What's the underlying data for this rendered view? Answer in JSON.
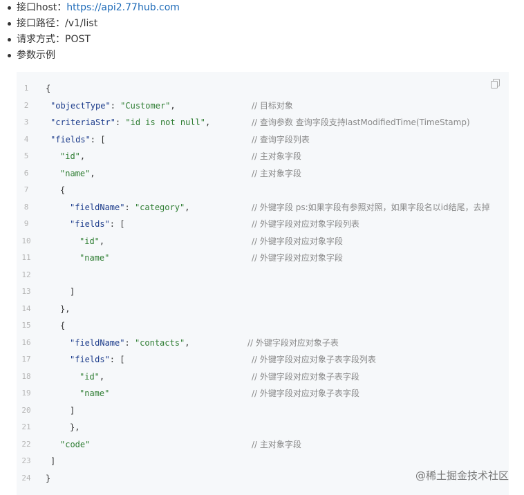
{
  "info": [
    {
      "label": "接口host：",
      "value": "https://api2.77hub.com",
      "is_link": true
    },
    {
      "label": "接口路径：",
      "value": "/v1/list",
      "is_link": false
    },
    {
      "label": "请求方式：",
      "value": "POST",
      "is_link": false
    },
    {
      "label": "参数示例",
      "value": "",
      "is_link": false
    }
  ],
  "code": {
    "copy_icon": "copy-icon",
    "lines": [
      {
        "n": "1",
        "indent": 0,
        "parts": [
          [
            "p",
            "{"
          ]
        ],
        "comment": ""
      },
      {
        "n": "2",
        "indent": 1,
        "parts": [
          [
            "k",
            "\"objectType\""
          ],
          [
            "p",
            ": "
          ],
          [
            "s",
            "\"Customer\""
          ],
          [
            "p",
            ","
          ]
        ],
        "comment": "// 目标对象"
      },
      {
        "n": "3",
        "indent": 1,
        "parts": [
          [
            "k",
            "\"criteriaStr\""
          ],
          [
            "p",
            ": "
          ],
          [
            "s",
            "\"id is not null\""
          ],
          [
            "p",
            ","
          ]
        ],
        "comment": "// 查询参数 查询字段支持lastModifiedTime(TimeStamp)"
      },
      {
        "n": "4",
        "indent": 1,
        "parts": [
          [
            "k",
            "\"fields\""
          ],
          [
            "p",
            ": ["
          ]
        ],
        "comment": "// 查询字段列表"
      },
      {
        "n": "5",
        "indent": 3,
        "parts": [
          [
            "s",
            "\"id\""
          ],
          [
            "p",
            ","
          ]
        ],
        "comment": "// 主对象字段"
      },
      {
        "n": "6",
        "indent": 3,
        "parts": [
          [
            "s",
            "\"name\""
          ],
          [
            "p",
            ","
          ]
        ],
        "comment": "// 主对象字段"
      },
      {
        "n": "7",
        "indent": 3,
        "parts": [
          [
            "p",
            "{"
          ]
        ],
        "comment": ""
      },
      {
        "n": "8",
        "indent": 5,
        "parts": [
          [
            "k",
            "\"fieldName\""
          ],
          [
            "p",
            ": "
          ],
          [
            "s",
            "\"category\""
          ],
          [
            "p",
            ","
          ]
        ],
        "comment": "// 外键字段 ps:如果字段有参照对照，如果字段名以id结尾，去掉"
      },
      {
        "n": "9",
        "indent": 5,
        "parts": [
          [
            "k",
            "\"fields\""
          ],
          [
            "p",
            ": ["
          ]
        ],
        "comment": "// 外键字段对应对象字段列表"
      },
      {
        "n": "10",
        "indent": 7,
        "parts": [
          [
            "s",
            "\"id\""
          ],
          [
            "p",
            ","
          ]
        ],
        "comment": "// 外键字段对应对象字段"
      },
      {
        "n": "11",
        "indent": 7,
        "parts": [
          [
            "s",
            "\"name\""
          ]
        ],
        "comment": "// 外键字段对应对象字段"
      },
      {
        "n": "12",
        "indent": 0,
        "parts": [],
        "comment": ""
      },
      {
        "n": "13",
        "indent": 5,
        "parts": [
          [
            "p",
            "]"
          ]
        ],
        "comment": ""
      },
      {
        "n": "14",
        "indent": 3,
        "parts": [
          [
            "p",
            "},"
          ]
        ],
        "comment": ""
      },
      {
        "n": "15",
        "indent": 3,
        "parts": [
          [
            "p",
            "{"
          ]
        ],
        "comment": ""
      },
      {
        "n": "16",
        "indent": 5,
        "parts": [
          [
            "k",
            "\"fieldName\""
          ],
          [
            "p",
            ": "
          ],
          [
            "s",
            "\"contacts\""
          ],
          [
            "p",
            ","
          ]
        ],
        "comment": "// 外键字段对应对象子表"
      },
      {
        "n": "17",
        "indent": 5,
        "parts": [
          [
            "k",
            "\"fields\""
          ],
          [
            "p",
            ": ["
          ]
        ],
        "comment": "// 外键字段对应对象子表字段列表"
      },
      {
        "n": "18",
        "indent": 7,
        "parts": [
          [
            "s",
            "\"id\""
          ],
          [
            "p",
            ","
          ]
        ],
        "comment": "// 外键字段对应对象子表字段"
      },
      {
        "n": "19",
        "indent": 7,
        "parts": [
          [
            "s",
            "\"name\""
          ]
        ],
        "comment": "// 外键字段对应对象子表字段"
      },
      {
        "n": "20",
        "indent": 5,
        "parts": [
          [
            "p",
            "]"
          ]
        ],
        "comment": ""
      },
      {
        "n": "21",
        "indent": 5,
        "parts": [
          [
            "p",
            "},"
          ]
        ],
        "comment": ""
      },
      {
        "n": "22",
        "indent": 3,
        "parts": [
          [
            "s",
            "\"code\""
          ]
        ],
        "comment": "// 主对象字段"
      },
      {
        "n": "23",
        "indent": 1,
        "parts": [
          [
            "p",
            "]"
          ]
        ],
        "comment": ""
      },
      {
        "n": "24",
        "indent": 0,
        "parts": [
          [
            "p",
            "}"
          ]
        ],
        "comment": ""
      }
    ]
  },
  "watermark": "@稀土掘金技术社区"
}
